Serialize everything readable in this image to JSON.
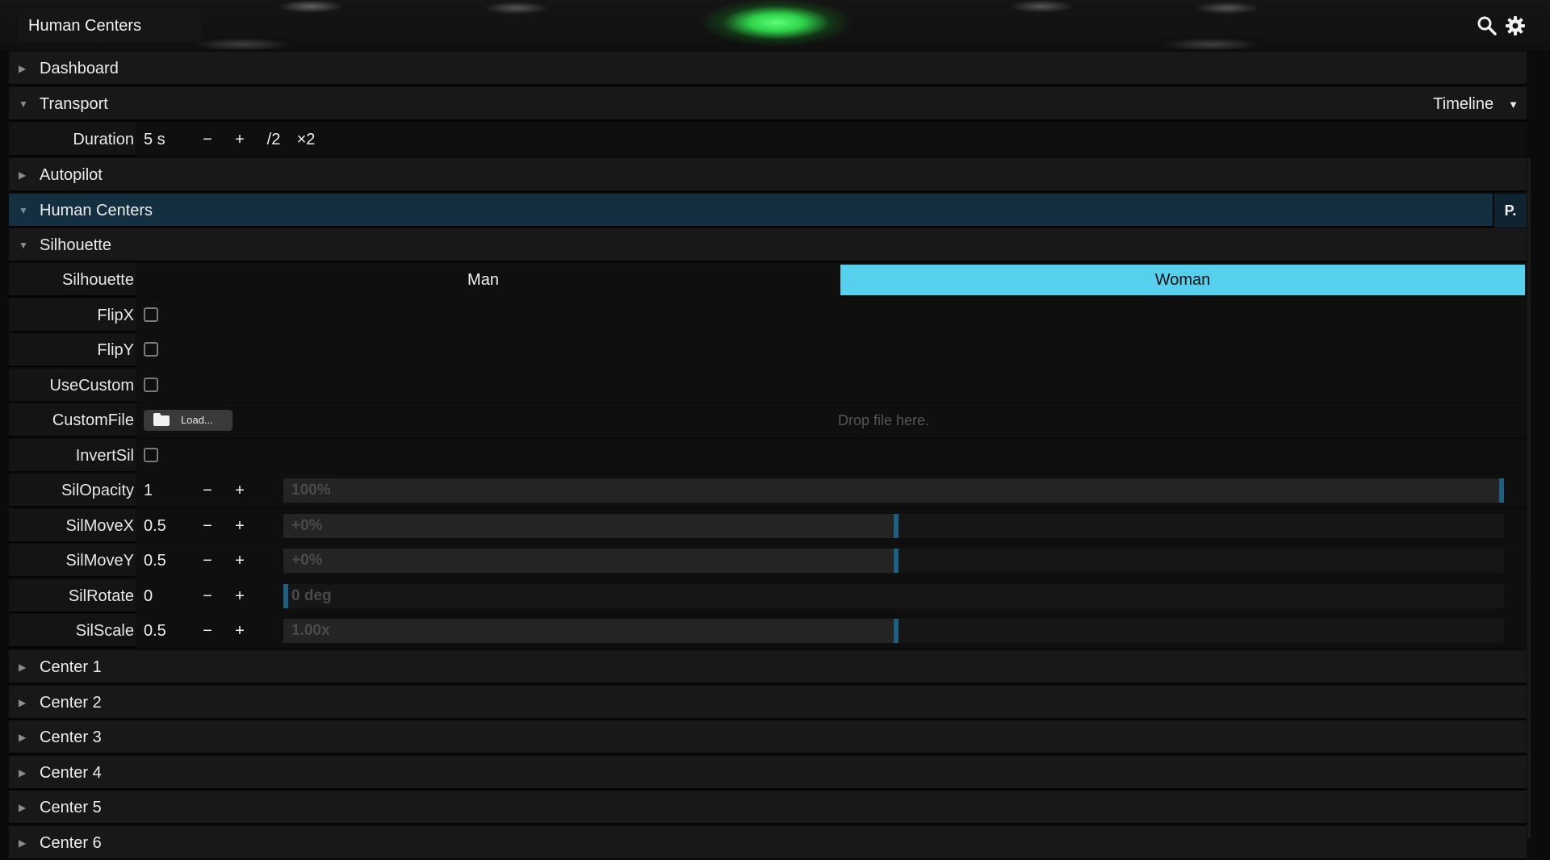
{
  "header": {
    "title": "Human Centers"
  },
  "icons": {
    "search": "search-icon",
    "settings": "gear-icon"
  },
  "folders": {
    "dashboard": "Dashboard",
    "transport": "Transport",
    "autopilot": "Autopilot",
    "human_centers": "Human Centers",
    "silhouette": "Silhouette"
  },
  "transport": {
    "mode": "Timeline",
    "duration_label": "Duration",
    "duration_value": "5 s",
    "minus": "−",
    "plus": "+",
    "half": "/2",
    "double": "×2"
  },
  "human_centers": {
    "p_button": "P."
  },
  "silhouette": {
    "choice_label": "Silhouette",
    "options": [
      "Man",
      "Woman"
    ],
    "selected": "Woman",
    "flipx_label": "FlipX",
    "flipx": false,
    "flipy_label": "FlipY",
    "flipy": false,
    "usecustom_label": "UseCustom",
    "usecustom": false,
    "customfile_label": "CustomFile",
    "load_label": "Load...",
    "drop_hint": "Drop file here.",
    "invertsil_label": "InvertSil",
    "invertsil": false
  },
  "sliders": [
    {
      "label": "SilOpacity",
      "value": "1",
      "display": "100%",
      "fraction": 1.0
    },
    {
      "label": "SilMoveX",
      "value": "0.5",
      "display": "+0%",
      "fraction": 0.5
    },
    {
      "label": "SilMoveY",
      "value": "0.5",
      "display": "+0%",
      "fraction": 0.5
    },
    {
      "label": "SilRotate",
      "value": "0",
      "display": "0 deg",
      "fraction": 0.0
    },
    {
      "label": "SilScale",
      "value": "0.5",
      "display": "1.00x",
      "fraction": 0.5
    }
  ],
  "centers": [
    "Center 1",
    "Center 2",
    "Center 3",
    "Center 4",
    "Center 5",
    "Center 6"
  ],
  "colors": {
    "accent": "#56d0ec",
    "active_header": "#143040",
    "slider_thumb": "#1e5f82"
  }
}
